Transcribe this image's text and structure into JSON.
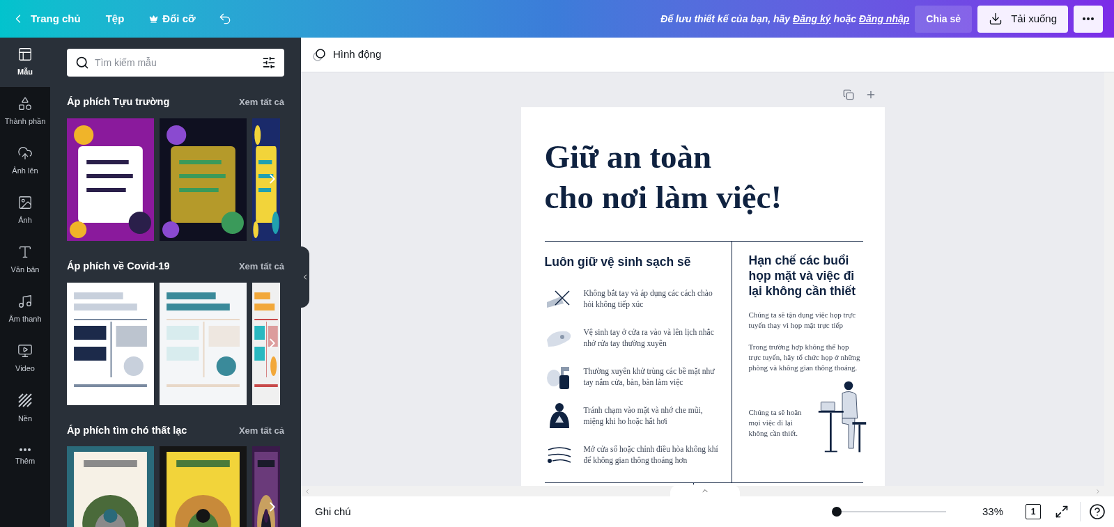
{
  "top_bar": {
    "back": "Trang chủ",
    "menu": [
      {
        "label": "Tệp",
        "kind": "plain"
      },
      {
        "label": "Đổi cỡ",
        "kind": "premium"
      }
    ],
    "save_prompt": {
      "before": "Để lưu thiết kế của bạn, hãy",
      "link_1": "Đăng ký",
      "middle": "hoặc",
      "link_2": "Đăng nhập"
    },
    "share_button": "Chia sẻ",
    "download_button": "Tải xuống"
  },
  "sidebar": {
    "items": [
      {
        "label": "Mẫu",
        "selected": true
      },
      {
        "label": "Thành phần",
        "selected": false
      },
      {
        "label": "Ảnh lên",
        "selected": false
      },
      {
        "label": "Ảnh",
        "selected": false
      },
      {
        "label": "Văn bản",
        "selected": false
      },
      {
        "label": "Âm thanh",
        "selected": false
      },
      {
        "label": "Video",
        "selected": false
      },
      {
        "label": "Nền",
        "selected": false
      },
      {
        "label": "Thêm",
        "selected": false
      }
    ]
  },
  "template_panel": {
    "search": {
      "placeholder": "Tìm kiếm mẫu"
    },
    "sections": [
      {
        "title": "Áp phích Tựu trường",
        "see_all": "Xem tất cả"
      },
      {
        "title": "Áp phích về Covid-19",
        "see_all": "Xem tất cả"
      },
      {
        "title": "Áp phích tìm chó thất lạc",
        "see_all": "Xem tất cả"
      }
    ]
  },
  "canvas_toolbar": {
    "animate": "Hình động"
  },
  "poster": {
    "title_lines": [
      "Giữ an toàn",
      "cho nơi làm việc!"
    ],
    "left_column": {
      "heading": "Luôn giữ vệ sinh sạch sẽ",
      "items": [
        "Không bắt tay và áp dụng các cách chào hỏi không tiếp xúc",
        "Vệ sinh tay ở cửa ra vào và lên lịch nhắc nhở rửa tay thường xuyên",
        "Thường xuyên khử trùng các bề mặt như tay nắm cửa, bàn, bàn làm việc",
        "Tránh chạm vào mặt và nhớ che mũi, miệng khi ho hoặc hắt hơi",
        "Mở cửa sổ hoặc chỉnh điều hòa không khí để không gian thông thoáng hơn"
      ]
    },
    "right_column": {
      "heading": "Hạn chế các buổi họp mặt và việc đi lại không cần thiết",
      "paragraphs": [
        "Chúng ta sẽ tận dụng việc họp trực tuyến thay vì họp mặt trực tiếp",
        "Trong trường hợp không thể họp trực tuyến, hãy tổ chức họp ở những phòng và không gian thông thoáng.",
        "Chúng ta sẽ hoãn mọi việc đi lại không cần thiết."
      ]
    }
  },
  "bottom_bar": {
    "notes": "Ghi chú",
    "zoom": {
      "level": 0,
      "reading": "33%"
    },
    "page_count": "1"
  }
}
